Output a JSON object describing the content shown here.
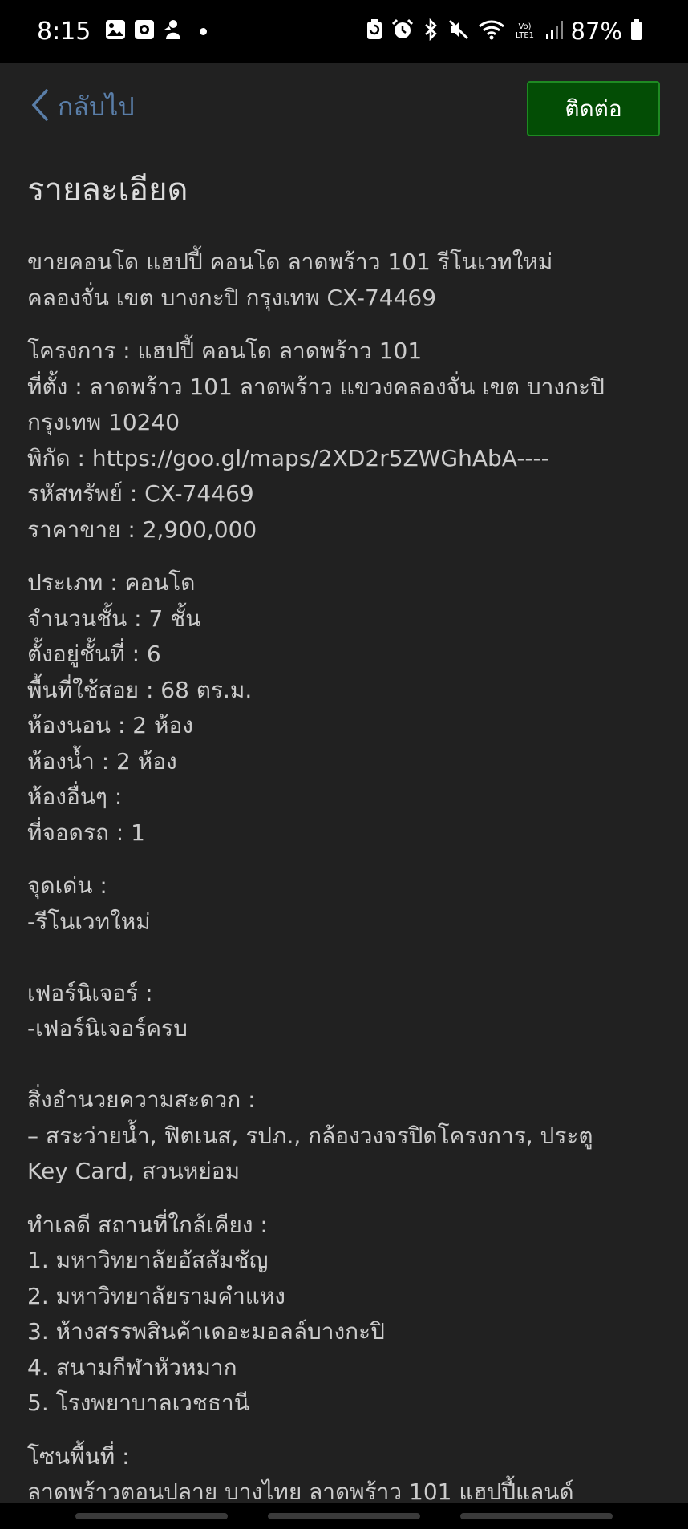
{
  "status_bar": {
    "time": "8:15",
    "battery": "87%",
    "icons_left": [
      "gallery-icon",
      "media-icon",
      "app-icon",
      "dot-icon"
    ],
    "icons_right": [
      "battery-saver-icon",
      "alarm-icon",
      "bluetooth-icon",
      "mute-icon",
      "wifi-icon",
      "volte-icon",
      "signal-icon",
      "battery-icon"
    ],
    "volte_text": "Vo) LTE1"
  },
  "toolbar": {
    "back_label": "กลับไป",
    "contact_label": "ติดต่อ"
  },
  "page_title": "รายละเอียด",
  "blocks": [
    [
      "ขายคอนโด แฮปปี้ คอนโด ลาดพร้าว 101 รีโนเวทใหม่",
      "คลองจั่น เขต บางกะปิ กรุงเทพ CX-74469"
    ],
    [
      "โครงการ : แฮปปี้ คอนโด ลาดพร้าว 101",
      "ที่ตั้ง : ลาดพร้าว 101 ลาดพร้าว แขวงคลองจั่น เขต บางกะปิ",
      "กรุงเทพ 10240",
      "พิกัด : https://goo.gl/maps/2XD2r5ZWGhAbA----",
      "รหัสทรัพย์ : CX-74469",
      "ราคาขาย : 2,900,000"
    ],
    [
      "ประเภท : คอนโด",
      "จำนวนชั้น : 7 ชั้น",
      "ตั้งอยู่ชั้นที่ : 6",
      "พื้นที่ใช้สอย : 68 ตร.ม.",
      "ห้องนอน : 2 ห้อง",
      "ห้องน้ำ : 2 ห้อง",
      "ห้องอื่นๆ :",
      "ที่จอดรถ : 1"
    ],
    [
      "จุดเด่น :",
      "-รีโนเวทใหม่",
      "",
      "เฟอร์นิเจอร์ :",
      "-เฟอร์นิเจอร์ครบ",
      "",
      "สิ่งอำนวยความสะดวก :",
      "– สระว่ายน้ำ, ฟิตเนส, รปภ., กล้องวงจรปิดโครงการ, ประตู",
      "Key Card, สวนหย่อม"
    ],
    [
      "ทำเลดี สถานที่ใกล้เคียง :",
      "1. มหาวิทยาลัยอัสสัมชัญ",
      "2. มหาวิทยาลัยรามคำแหง",
      "3. ห้างสรรพสินค้าเดอะมอลล์บางกะปิ",
      "4. สนามกีฬาหัวหมาก",
      "5. โรงพยาบาลเวชธานี"
    ],
    [
      "โซนพื้นที่ :",
      "ลาดพร้าวตอนปลาย บางไทย ลาดพร้าว 101 แฮปปี้แลนด์"
    ]
  ]
}
